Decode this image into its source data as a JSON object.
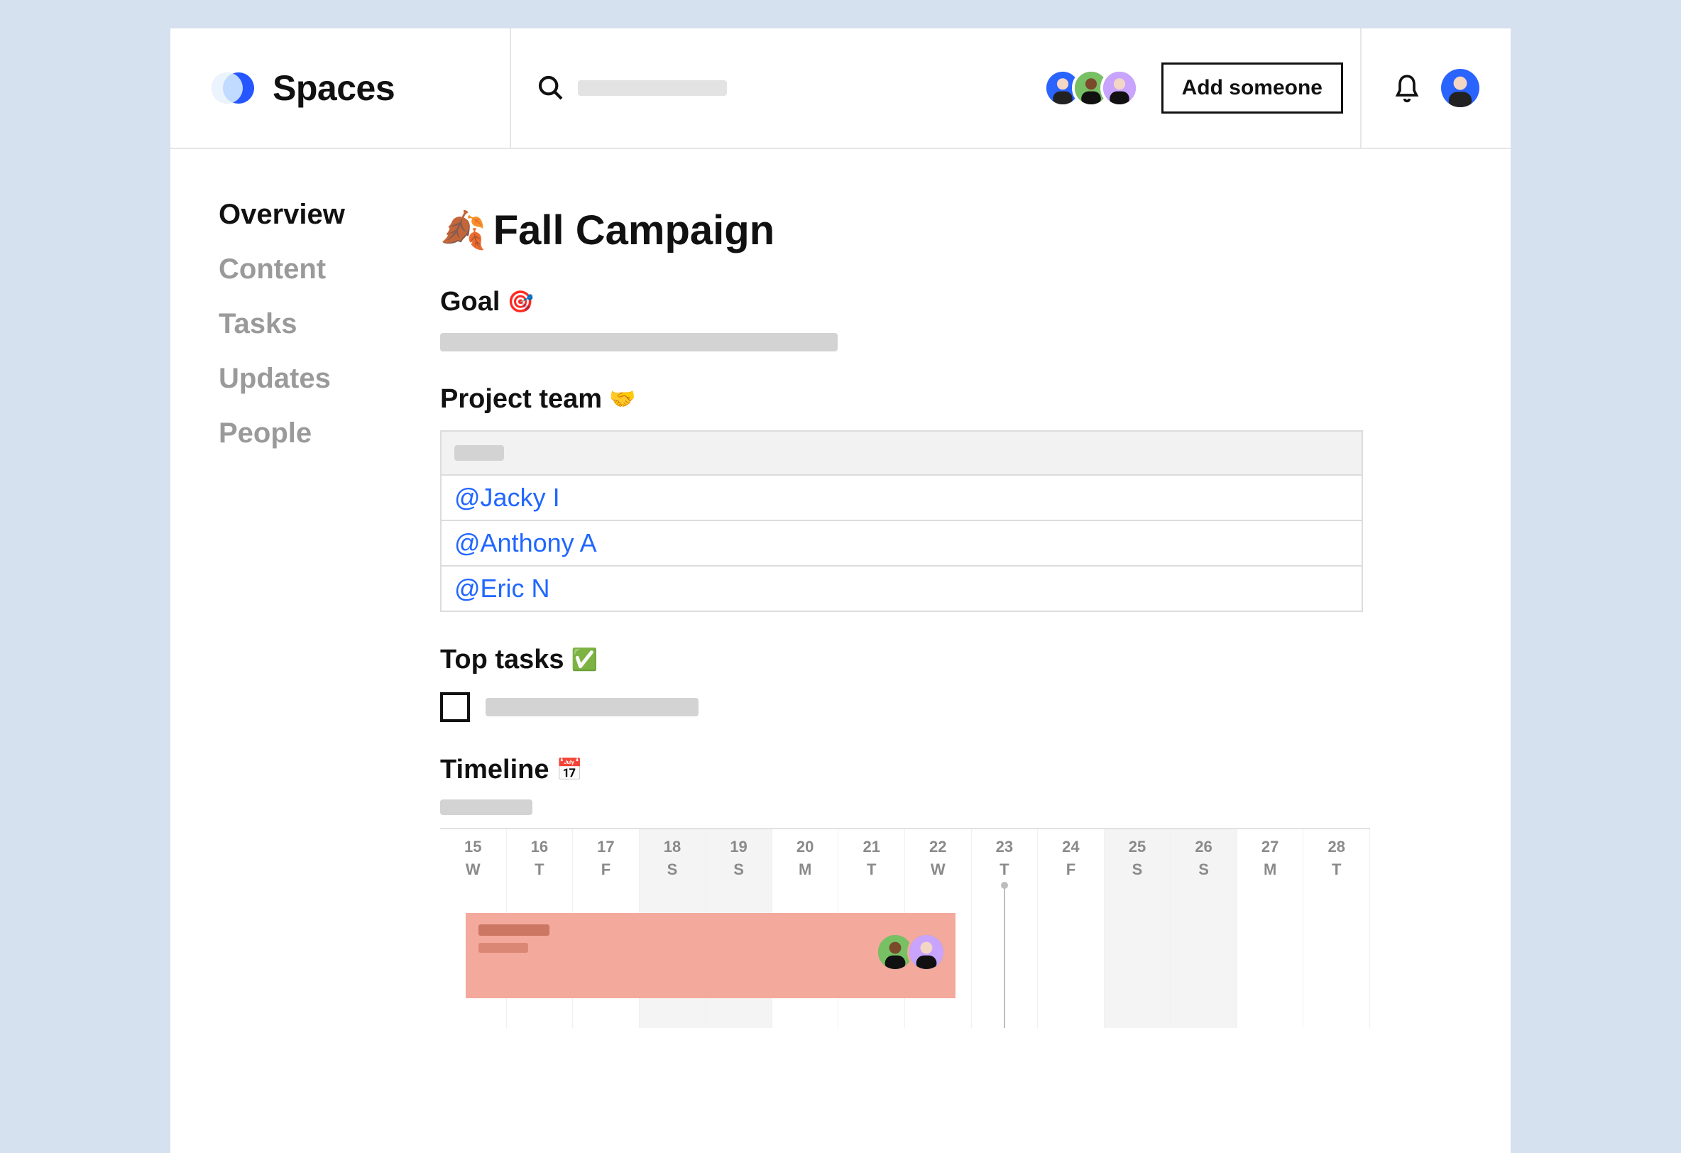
{
  "brand": {
    "name": "Spaces"
  },
  "header": {
    "add_button_label": "Add someone"
  },
  "avatars": {
    "colors": [
      "#2a64ff",
      "#77c063",
      "#c9a4ff"
    ]
  },
  "sidebar": {
    "items": [
      {
        "label": "Overview",
        "active": true
      },
      {
        "label": "Content",
        "active": false
      },
      {
        "label": "Tasks",
        "active": false
      },
      {
        "label": "Updates",
        "active": false
      },
      {
        "label": "People",
        "active": false
      }
    ]
  },
  "page": {
    "title_emoji": "🍂",
    "title_text": "Fall Campaign",
    "sections": {
      "goal": {
        "label": "Goal",
        "emoji": "🎯"
      },
      "team": {
        "label": "Project team",
        "emoji": "🤝"
      },
      "tasks": {
        "label": "Top tasks",
        "emoji": "✅"
      },
      "timeline": {
        "label": "Timeline",
        "emoji": "📅"
      }
    },
    "team_members": [
      "@Jacky I",
      "@Anthony A",
      "@Eric N"
    ]
  },
  "timeline": {
    "days": [
      {
        "num": "15",
        "dow": "W",
        "weekend": false,
        "today": false
      },
      {
        "num": "16",
        "dow": "T",
        "weekend": false,
        "today": false
      },
      {
        "num": "17",
        "dow": "F",
        "weekend": false,
        "today": false
      },
      {
        "num": "18",
        "dow": "S",
        "weekend": true,
        "today": false
      },
      {
        "num": "19",
        "dow": "S",
        "weekend": true,
        "today": false
      },
      {
        "num": "20",
        "dow": "M",
        "weekend": false,
        "today": false
      },
      {
        "num": "21",
        "dow": "T",
        "weekend": false,
        "today": false
      },
      {
        "num": "22",
        "dow": "W",
        "weekend": false,
        "today": false
      },
      {
        "num": "23",
        "dow": "T",
        "weekend": false,
        "today": true
      },
      {
        "num": "24",
        "dow": "F",
        "weekend": false,
        "today": false
      },
      {
        "num": "25",
        "dow": "S",
        "weekend": true,
        "today": false
      },
      {
        "num": "26",
        "dow": "S",
        "weekend": true,
        "today": false
      },
      {
        "num": "27",
        "dow": "M",
        "weekend": false,
        "today": false
      },
      {
        "num": "28",
        "dow": "T",
        "weekend": false,
        "today": false
      }
    ],
    "event": {
      "assignee_colors": [
        "#77c063",
        "#c9a4ff"
      ]
    }
  }
}
